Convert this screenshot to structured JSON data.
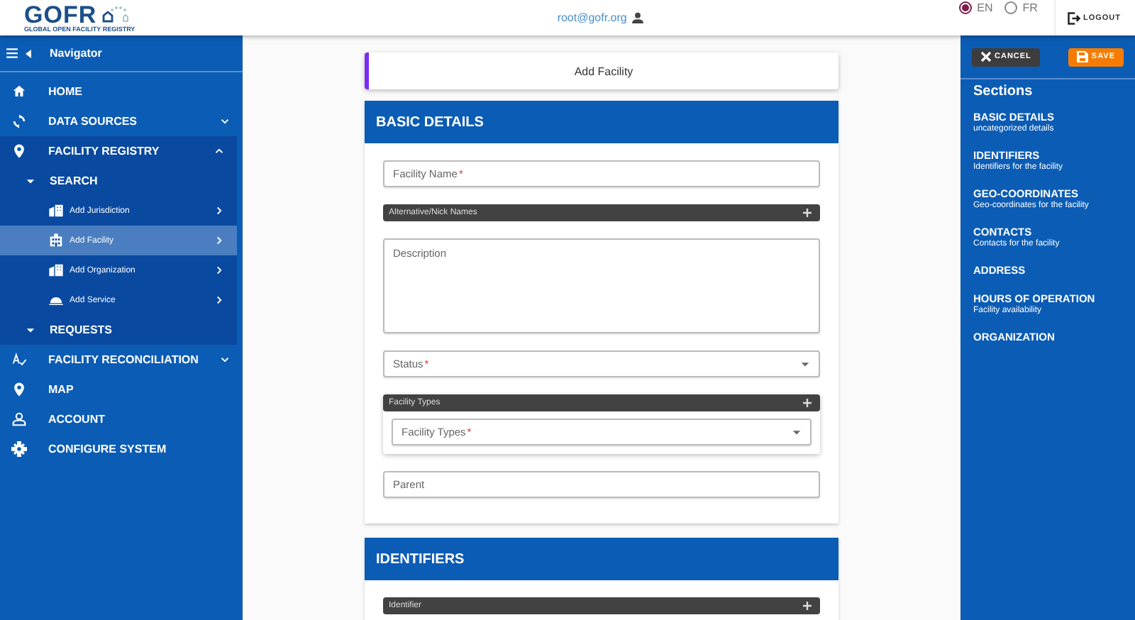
{
  "header": {
    "logo_title": "GOFR",
    "logo_subtitle": "GLOBAL OPEN FACILITY REGISTRY",
    "user": "root@gofr.org",
    "languages": [
      {
        "label": "EN",
        "selected": true
      },
      {
        "label": "FR",
        "selected": false
      }
    ],
    "logout": "LOGOUT"
  },
  "navigator": {
    "title": "Navigator",
    "items": [
      {
        "label": "HOME"
      },
      {
        "label": "DATA SOURCES",
        "expanded": false
      },
      {
        "label": "FACILITY REGISTRY",
        "expanded": true,
        "children": [
          {
            "label": "SEARCH",
            "children": [
              {
                "label": "Add Jurisdiction",
                "selected": false
              },
              {
                "label": "Add Facility",
                "selected": true
              },
              {
                "label": "Add Organization",
                "selected": false
              },
              {
                "label": "Add Service",
                "selected": false
              }
            ]
          },
          {
            "label": "REQUESTS"
          }
        ]
      },
      {
        "label": "FACILITY RECONCILIATION",
        "expanded": false
      },
      {
        "label": "MAP"
      },
      {
        "label": "ACCOUNT"
      },
      {
        "label": "CONFIGURE SYSTEM"
      }
    ]
  },
  "form": {
    "title": "Add Facility",
    "sections": [
      {
        "title": "BASIC DETAILS",
        "fields": [
          {
            "kind": "text",
            "label": "Facility Name",
            "mark": "*"
          },
          {
            "kind": "list",
            "label": "Alternative/Nick Names"
          },
          {
            "kind": "textarea",
            "label": "Description"
          },
          {
            "kind": "select",
            "label": "Status",
            "mark": "*"
          },
          {
            "kind": "list",
            "label": "Facility Types",
            "children": [
              {
                "kind": "select",
                "label": "Facility Types",
                "mark": "*"
              }
            ]
          },
          {
            "kind": "text",
            "label": "Parent"
          }
        ]
      },
      {
        "title": "IDENTIFIERS",
        "fields": [
          {
            "kind": "list",
            "label": "Identifier"
          }
        ]
      }
    ]
  },
  "sections_panel": {
    "cancel": "CANCEL",
    "save": "SAVE",
    "title": "Sections",
    "items": [
      {
        "title": "BASIC DETAILS",
        "subtitle": "uncategorized details"
      },
      {
        "title": "IDENTIFIERS",
        "subtitle": "Identifiers for the facility"
      },
      {
        "title": "GEO-COORDINATES",
        "subtitle": "Geo-coordinates for the facility"
      },
      {
        "title": "CONTACTS",
        "subtitle": "Contacts for the facility"
      },
      {
        "title": "ADDRESS"
      },
      {
        "title": "HOURS OF OPERATION",
        "subtitle": "Facility availability"
      },
      {
        "title": "ORGANIZATION"
      }
    ]
  }
}
